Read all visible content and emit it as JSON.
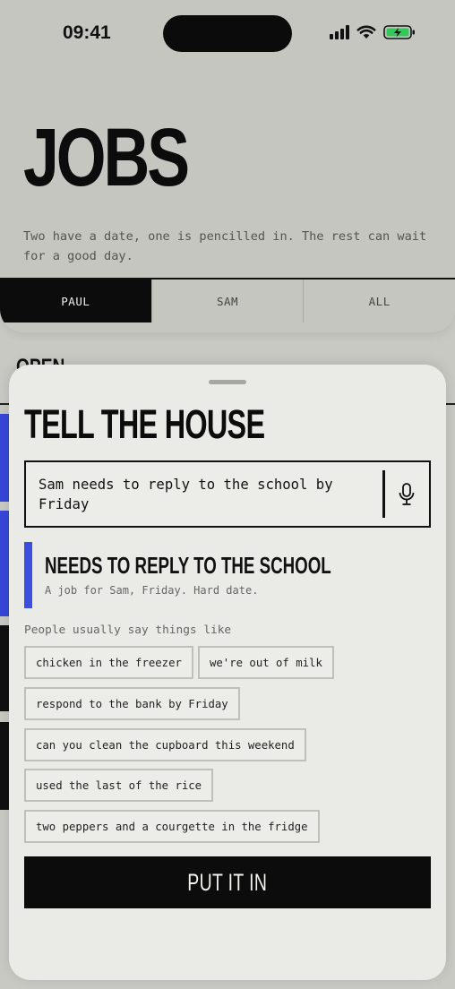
{
  "status_bar": {
    "time": "09:41"
  },
  "header": {
    "title": "JOBS",
    "subtitle": "Two have a date, one is pencilled in. The rest can wait for a good day."
  },
  "tabs": [
    {
      "label": "PAUL",
      "active": true
    },
    {
      "label": "SAM",
      "active": false
    },
    {
      "label": "ALL",
      "active": false
    }
  ],
  "background": {
    "section_heading": "OPEN"
  },
  "sheet": {
    "title": "TELL THE HOUSE",
    "input": {
      "value": "Sam needs to reply to the school by Friday"
    },
    "preview": {
      "title": "NEEDS TO REPLY TO THE SCHOOL",
      "description": "A job for Sam, Friday. Hard date.",
      "accent_color": "#3a4fe0"
    },
    "hint": "People usually say things like",
    "suggestions": [
      "chicken in the freezer",
      "we're out of milk",
      "respond to the bank by Friday",
      "can you clean the cupboard this weekend",
      "used the last of the rice",
      "two peppers and a courgette in the fridge"
    ],
    "submit_label": "PUT IT IN"
  }
}
